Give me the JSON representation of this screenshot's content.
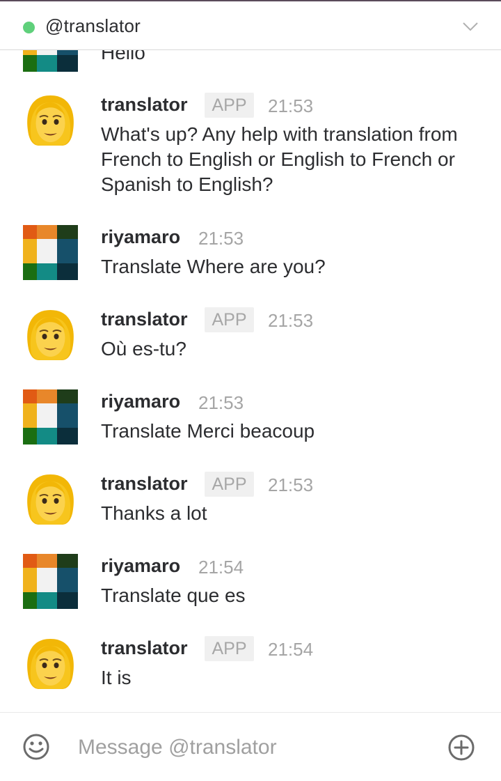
{
  "header": {
    "title": "@translator",
    "status_color": "#5fd07b"
  },
  "colors": {
    "name": "#2c2d30",
    "timestamp": "#a5a5a5",
    "badge_bg": "#f0f0f0",
    "badge_text": "#a7a7a7"
  },
  "messages": [
    {
      "author": "",
      "badge": "",
      "time": "",
      "text": "Hello",
      "avatar": "riyamaro-avatar"
    },
    {
      "author": "translator",
      "badge": "APP",
      "time": "21:53",
      "text": "What's up? Any help with translation from French to English or English to French or Spanish to English?",
      "avatar": "translator-avatar"
    },
    {
      "author": "riyamaro",
      "badge": "",
      "time": "21:53",
      "text": "Translate Where are you?",
      "avatar": "riyamaro-avatar"
    },
    {
      "author": "translator",
      "badge": "APP",
      "time": "21:53",
      "text": "Où es-tu?",
      "avatar": "translator-avatar"
    },
    {
      "author": "riyamaro",
      "badge": "",
      "time": "21:53",
      "text": "Translate Merci beacoup",
      "avatar": "riyamaro-avatar"
    },
    {
      "author": "translator",
      "badge": "APP",
      "time": "21:53",
      "text": "Thanks a lot",
      "avatar": "translator-avatar"
    },
    {
      "author": "riyamaro",
      "badge": "",
      "time": "21:54",
      "text": "Translate que es",
      "avatar": "riyamaro-avatar"
    },
    {
      "author": "translator",
      "badge": "APP",
      "time": "21:54",
      "text": "It is",
      "avatar": "translator-avatar"
    }
  ],
  "composer": {
    "placeholder": "Message @translator",
    "left_icon": "emoji-icon",
    "right_icon": "plus-circle-icon"
  }
}
